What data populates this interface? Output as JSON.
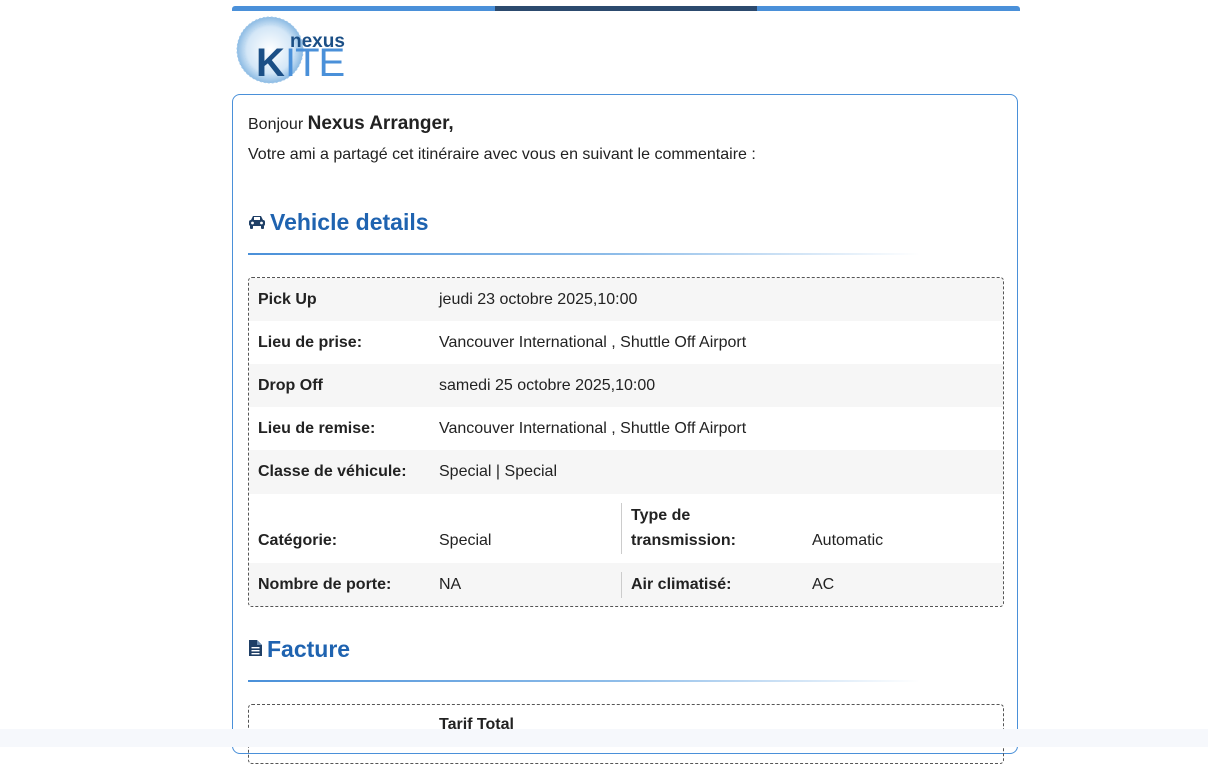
{
  "brand": {
    "logo_small": "nexus",
    "logo_big": "KITE"
  },
  "greeting": {
    "prefix": "Bonjour",
    "name": "Nexus Arranger,"
  },
  "message": "Votre ami a partagé cet itinéraire avec vous en suivant le commentaire :",
  "vehicle": {
    "title": "Vehicle details",
    "icon": "car-icon",
    "rows": [
      {
        "label": "Pick Up",
        "value": "jeudi 23 octobre 2025,10:00"
      },
      {
        "label": "Lieu de prise:",
        "value": "Vancouver International , Shuttle Off Airport"
      },
      {
        "label": "Drop Off",
        "value": "samedi 25 octobre 2025,10:00"
      },
      {
        "label": "Lieu de remise:",
        "value": "Vancouver International , Shuttle Off Airport"
      },
      {
        "label": "Classe de véhicule:",
        "value": "Special | Special"
      }
    ],
    "pairs": [
      {
        "label": "Catégorie:",
        "value": "Special",
        "label2_line1": "Type de",
        "label2_line2": "transmission:",
        "value2": "Automatic"
      },
      {
        "label": "Nombre de porte:",
        "value": "NA",
        "label2": "Air climatisé:",
        "value2": "AC"
      }
    ]
  },
  "invoice": {
    "title": "Facture",
    "icon": "document-icon",
    "first_label": "Tarif Total"
  },
  "colors": {
    "accent": "#4a90d9",
    "accent_dark": "#2c4a6e",
    "heading": "#1f63b0"
  }
}
